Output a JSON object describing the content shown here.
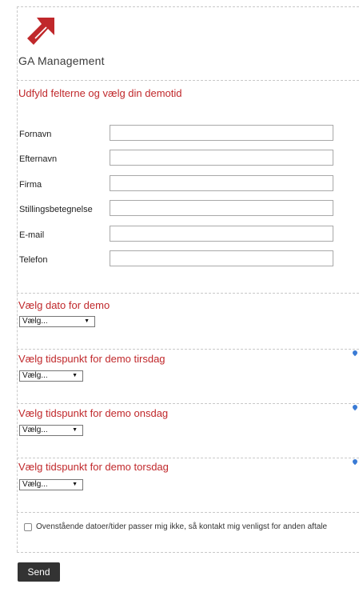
{
  "brand": {
    "name": "GA Management",
    "accent": "#c0282b"
  },
  "sections": {
    "intro_title": "Udfyld felterne og vælg din demotid",
    "date_title": "Vælg dato for demo",
    "tue_title": "Vælg tidspunkt for demo tirsdag",
    "wed_title": "Vælg tidspunkt for demo onsdag",
    "thu_title": "Vælg tidspunkt for demo torsdag"
  },
  "fields": [
    {
      "label": "Fornavn",
      "value": ""
    },
    {
      "label": "Efternavn",
      "value": ""
    },
    {
      "label": "Firma",
      "value": ""
    },
    {
      "label": "Stillingsbetegnelse",
      "value": ""
    },
    {
      "label": "E-mail",
      "value": ""
    },
    {
      "label": "Telefon",
      "value": ""
    }
  ],
  "selects": {
    "date": "Vælg...",
    "tue": "Vælg...",
    "wed": "Vælg...",
    "thu": "Vælg..."
  },
  "checkbox": {
    "label": "Ovenstående datoer/tider passer mig ikke, så kontakt mig venligst for anden aftale",
    "checked": false
  },
  "send_label": "Send"
}
